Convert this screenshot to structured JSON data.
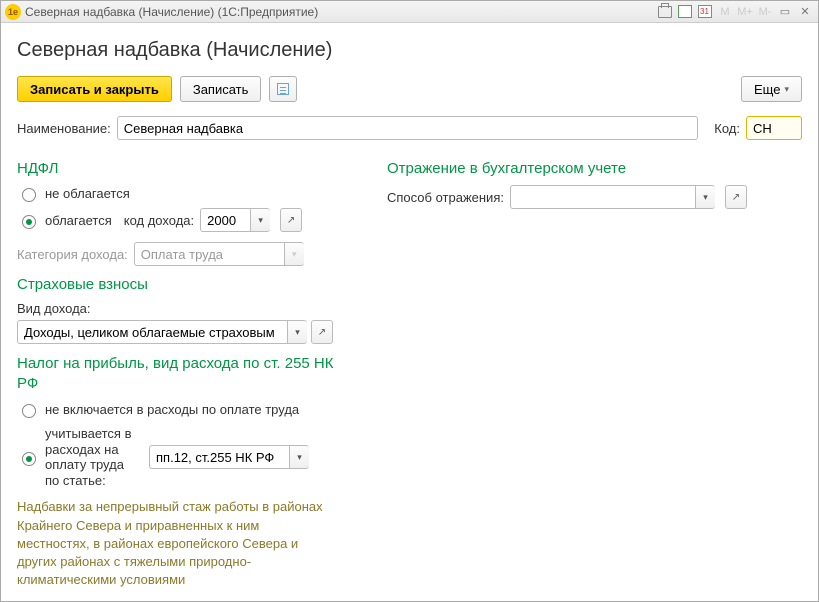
{
  "titlebar": {
    "app_icon_text": "1e",
    "title": "Северная надбавка (Начисление)  (1С:Предприятие)"
  },
  "page_title": "Северная надбавка (Начисление)",
  "toolbar": {
    "save_close": "Записать и закрыть",
    "save": "Записать",
    "more": "Еще"
  },
  "name_row": {
    "label": "Наименование:",
    "value": "Северная надбавка",
    "code_label": "Код:",
    "code_value": "СН"
  },
  "left": {
    "ndfl": {
      "header": "НДФЛ",
      "not_taxed": "не облагается",
      "taxed": "облагается",
      "income_code_label": "код дохода:",
      "income_code_value": "2000",
      "category_label": "Категория дохода:",
      "category_value": "Оплата труда"
    },
    "insurance": {
      "header": "Страховые взносы",
      "income_type_label": "Вид дохода:",
      "income_type_value": "Доходы, целиком облагаемые страховым"
    },
    "profit_tax": {
      "header": "Налог на прибыль, вид расхода по ст. 255 НК РФ",
      "not_included": "не включается в расходы по оплате труда",
      "included_label": "учитывается в расходах на оплату труда по статье:",
      "article_value": "пп.12, ст.255 НК РФ"
    },
    "description": "Надбавки за непрерывный стаж работы в районах Крайнего Севера и приравненных к ним местностях, в районах европейского Севера и других районах с тяжелыми природно-климатическими условиями"
  },
  "right": {
    "accounting": {
      "header": "Отражение в бухгалтерском учете",
      "method_label": "Способ отражения:",
      "method_value": ""
    }
  }
}
